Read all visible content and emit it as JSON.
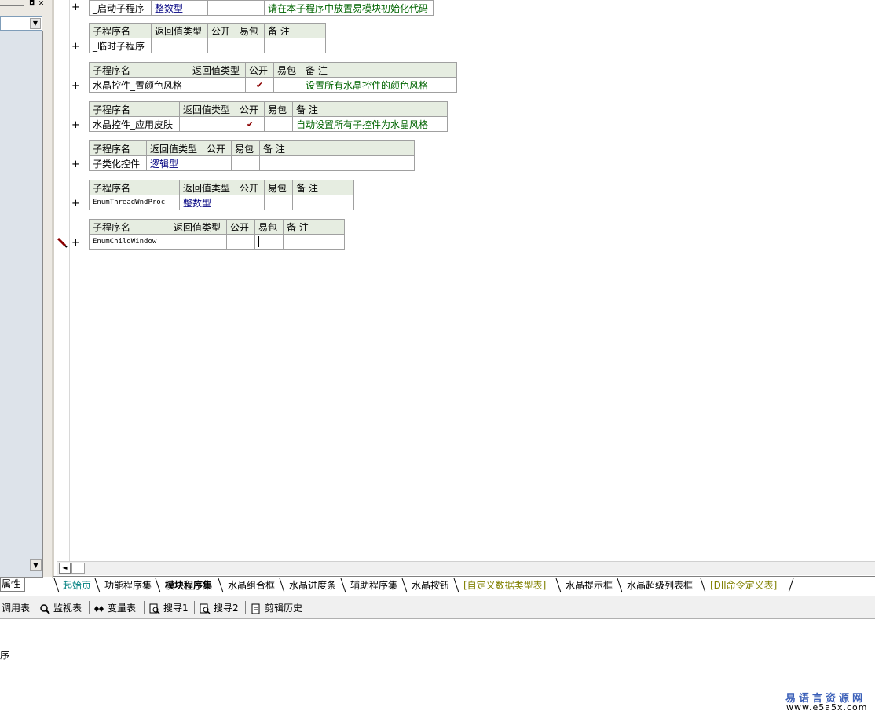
{
  "left_panel": {
    "window_buttons": [
      "◘",
      "✕"
    ],
    "combo_arrow": "▼",
    "scroll_arrow": "▼",
    "tab_label": "属性"
  },
  "procedures": [
    {
      "header": [],
      "row": [
        "_启动子程序",
        "整数型",
        "",
        "",
        "请在本子程序中放置易模块初始化代码"
      ],
      "row_classes": [
        "",
        "type",
        "",
        "",
        "comment"
      ]
    },
    {
      "header": [
        "子程序名",
        "返回值类型",
        "公开",
        "易包",
        "备 注"
      ],
      "row": [
        "_临时子程序",
        "",
        "",
        "",
        ""
      ],
      "row_classes": [
        "",
        "type",
        "",
        "",
        "comment"
      ]
    },
    {
      "header": [
        "子程序名",
        "返回值类型",
        "公开",
        "易包",
        "备 注"
      ],
      "row": [
        "水晶控件_置颜色风格",
        "",
        "✔",
        "",
        "设置所有水晶控件的颜色风格"
      ],
      "row_classes": [
        "",
        "type",
        "check",
        "",
        "comment"
      ]
    },
    {
      "header": [
        "子程序名",
        "返回值类型",
        "公开",
        "易包",
        "备 注"
      ],
      "row": [
        "水晶控件_应用皮肤",
        "",
        "✔",
        "",
        "自动设置所有子控件为水晶风格"
      ],
      "row_classes": [
        "",
        "type",
        "check",
        "",
        "comment"
      ]
    },
    {
      "header": [
        "子程序名",
        "返回值类型",
        "公开",
        "易包",
        "备 注"
      ],
      "row": [
        "子类化控件",
        "逻辑型",
        "",
        "",
        ""
      ],
      "row_classes": [
        "",
        "type",
        "",
        "",
        "comment"
      ]
    },
    {
      "header": [
        "子程序名",
        "返回值类型",
        "公开",
        "易包",
        "备 注"
      ],
      "row": [
        "EnumThreadWndProc",
        "整数型",
        "",
        "",
        ""
      ],
      "row_classes": [
        "eng",
        "type",
        "",
        "",
        "comment"
      ]
    },
    {
      "header": [
        "子程序名",
        "返回值类型",
        "公开",
        "易包",
        "备 注"
      ],
      "row": [
        "EnumChildWindow",
        "",
        "",
        "",
        ""
      ],
      "row_classes": [
        "eng",
        "type",
        "",
        "",
        "comment"
      ]
    }
  ],
  "expand_symbol": "+",
  "scroll_left_arrow": "◄",
  "tabs": [
    {
      "label": "起始页",
      "style": "teal"
    },
    {
      "label": "功能程序集",
      "style": ""
    },
    {
      "label": "模块程序集",
      "style": "active"
    },
    {
      "label": "水晶组合框",
      "style": ""
    },
    {
      "label": "水晶进度条",
      "style": ""
    },
    {
      "label": "辅助程序集",
      "style": ""
    },
    {
      "label": "水晶按钮",
      "style": ""
    },
    {
      "label": "[自定义数据类型表]",
      "style": "olive"
    },
    {
      "label": "水晶提示框",
      "style": ""
    },
    {
      "label": "水晶超级列表框",
      "style": ""
    },
    {
      "label": "[Dll命令定义表]",
      "style": "olive"
    }
  ],
  "toolbar": [
    {
      "label": "调用表",
      "icon": "call-table-icon"
    },
    {
      "label": "监视表",
      "icon": "magnifier-icon"
    },
    {
      "label": "变量表",
      "icon": "variables-icon"
    },
    {
      "label": "搜寻1",
      "icon": "search1-icon"
    },
    {
      "label": "搜寻2",
      "icon": "search2-icon"
    },
    {
      "label": "剪辑历史",
      "icon": "clipboard-history-icon"
    }
  ],
  "output_text": "序",
  "watermark": {
    "cn": "易语言资源网",
    "url": "www.e5a5x.com"
  }
}
